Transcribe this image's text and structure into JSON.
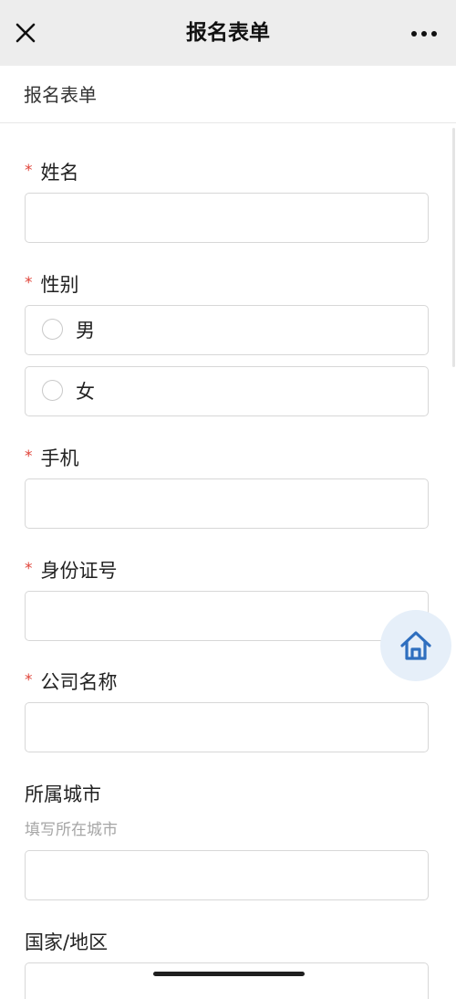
{
  "navbar": {
    "title": "报名表单",
    "close_icon": "close-icon",
    "more_icon": "more-dots-icon"
  },
  "page": {
    "header_title": "报名表单"
  },
  "form": {
    "required_mark": "*",
    "name": {
      "label": "姓名",
      "value": ""
    },
    "gender": {
      "label": "性别",
      "options": [
        "男",
        "女"
      ]
    },
    "phone": {
      "label": "手机",
      "value": ""
    },
    "id_number": {
      "label": "身份证号",
      "value": ""
    },
    "company": {
      "label": "公司名称",
      "value": ""
    },
    "city": {
      "label": "所属城市",
      "hint": "填写所在城市",
      "value": ""
    },
    "country": {
      "label": "国家/地区",
      "value": ""
    }
  },
  "floating": {
    "home_icon": "home-icon",
    "accent_color": "#2f6fbf"
  },
  "colors": {
    "required": "#e0443a",
    "nav_background": "#ededed",
    "input_border": "#d7d7d7",
    "hint_text": "#a6a6a6"
  }
}
